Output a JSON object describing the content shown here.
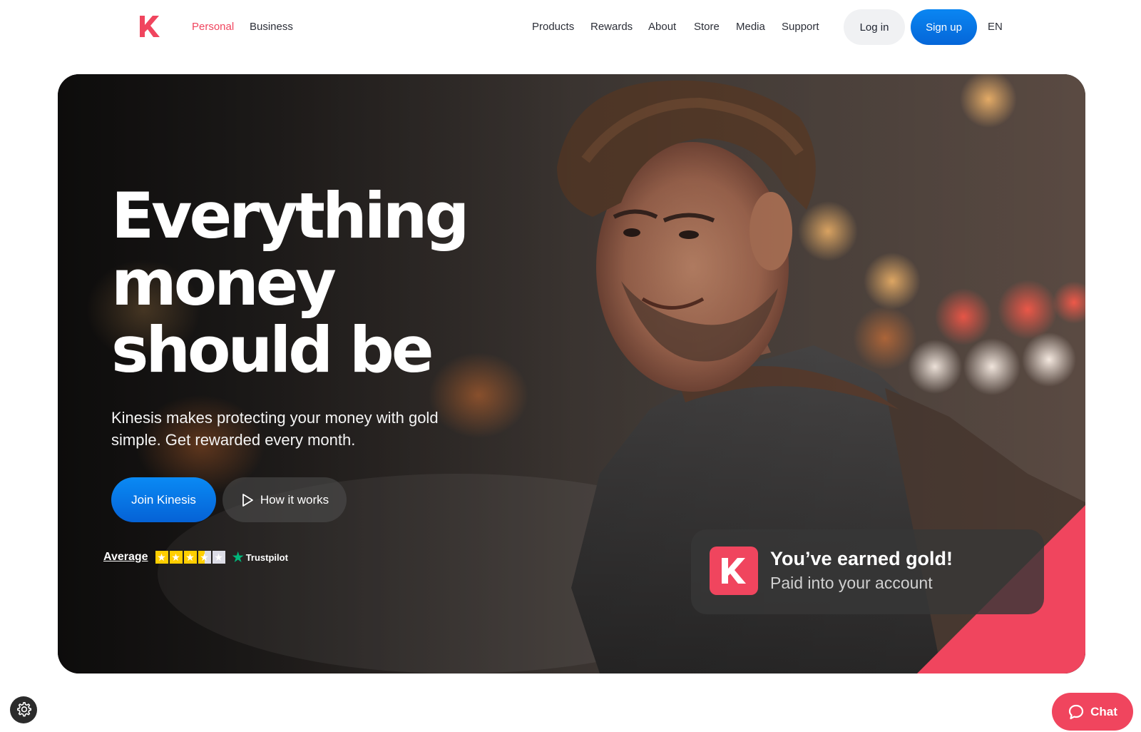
{
  "brand": {
    "name": "Kinesis",
    "accent": "#f0455e",
    "primary_blue": "#0a86f2"
  },
  "nav": {
    "left_links": [
      {
        "label": "Personal",
        "active": true
      },
      {
        "label": "Business",
        "active": false
      }
    ],
    "links": [
      "Products",
      "Rewards",
      "About",
      "Store",
      "Media",
      "Support"
    ],
    "login_label": "Log in",
    "signup_label": "Sign up",
    "language": "EN"
  },
  "hero": {
    "headline": [
      "Everything",
      "money",
      "should be"
    ],
    "subtitle": "Kinesis makes protecting your money with gold simple. Get rewarded every month.",
    "cta_primary": "Join Kinesis",
    "cta_secondary": "How it works",
    "trustpilot": {
      "rating_label": "Average",
      "stars": 3.5,
      "max_stars": 5,
      "brand": "Trustpilot"
    }
  },
  "toast": {
    "title": "You’ve earned gold!",
    "subtitle": "Paid into your account",
    "icon": "kinesis-k-logo"
  },
  "floating": {
    "settings_icon": "gear-icon",
    "chat_label": "Chat",
    "chat_icon": "chat-bubble-icon"
  }
}
